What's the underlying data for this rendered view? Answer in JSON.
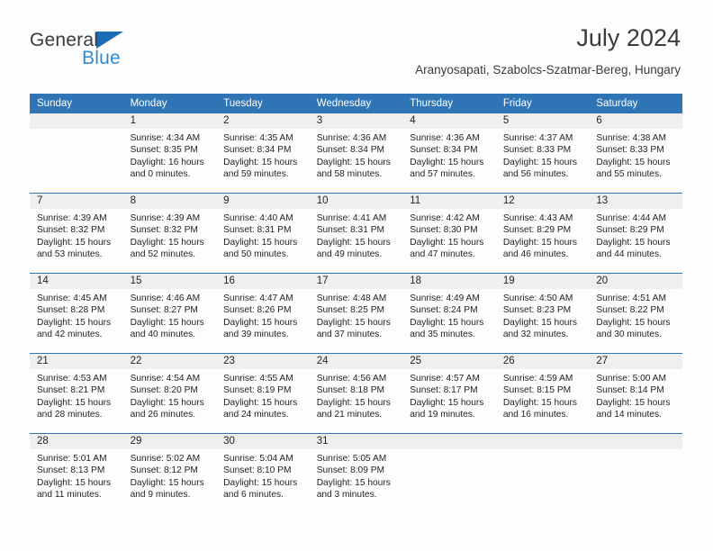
{
  "brand": {
    "name_part1": "General",
    "name_part2": "Blue",
    "logo_icon": "triangle-logo-icon"
  },
  "header": {
    "title": "July 2024",
    "subtitle": "Aranyosapati, Szabolcs-Szatmar-Bereg, Hungary"
  },
  "colors": {
    "header_blue": "#2f74b5",
    "brand_blue": "#2e8bd4",
    "daynum_band": "#efefef",
    "text": "#231f20"
  },
  "weekdays": [
    "Sunday",
    "Monday",
    "Tuesday",
    "Wednesday",
    "Thursday",
    "Friday",
    "Saturday"
  ],
  "weeks": [
    [
      {
        "day": "",
        "sunrise": "",
        "sunset": "",
        "daylight_1": "",
        "daylight_2": ""
      },
      {
        "day": "1",
        "sunrise": "Sunrise: 4:34 AM",
        "sunset": "Sunset: 8:35 PM",
        "daylight_1": "Daylight: 16 hours",
        "daylight_2": "and 0 minutes."
      },
      {
        "day": "2",
        "sunrise": "Sunrise: 4:35 AM",
        "sunset": "Sunset: 8:34 PM",
        "daylight_1": "Daylight: 15 hours",
        "daylight_2": "and 59 minutes."
      },
      {
        "day": "3",
        "sunrise": "Sunrise: 4:36 AM",
        "sunset": "Sunset: 8:34 PM",
        "daylight_1": "Daylight: 15 hours",
        "daylight_2": "and 58 minutes."
      },
      {
        "day": "4",
        "sunrise": "Sunrise: 4:36 AM",
        "sunset": "Sunset: 8:34 PM",
        "daylight_1": "Daylight: 15 hours",
        "daylight_2": "and 57 minutes."
      },
      {
        "day": "5",
        "sunrise": "Sunrise: 4:37 AM",
        "sunset": "Sunset: 8:33 PM",
        "daylight_1": "Daylight: 15 hours",
        "daylight_2": "and 56 minutes."
      },
      {
        "day": "6",
        "sunrise": "Sunrise: 4:38 AM",
        "sunset": "Sunset: 8:33 PM",
        "daylight_1": "Daylight: 15 hours",
        "daylight_2": "and 55 minutes."
      }
    ],
    [
      {
        "day": "7",
        "sunrise": "Sunrise: 4:39 AM",
        "sunset": "Sunset: 8:32 PM",
        "daylight_1": "Daylight: 15 hours",
        "daylight_2": "and 53 minutes."
      },
      {
        "day": "8",
        "sunrise": "Sunrise: 4:39 AM",
        "sunset": "Sunset: 8:32 PM",
        "daylight_1": "Daylight: 15 hours",
        "daylight_2": "and 52 minutes."
      },
      {
        "day": "9",
        "sunrise": "Sunrise: 4:40 AM",
        "sunset": "Sunset: 8:31 PM",
        "daylight_1": "Daylight: 15 hours",
        "daylight_2": "and 50 minutes."
      },
      {
        "day": "10",
        "sunrise": "Sunrise: 4:41 AM",
        "sunset": "Sunset: 8:31 PM",
        "daylight_1": "Daylight: 15 hours",
        "daylight_2": "and 49 minutes."
      },
      {
        "day": "11",
        "sunrise": "Sunrise: 4:42 AM",
        "sunset": "Sunset: 8:30 PM",
        "daylight_1": "Daylight: 15 hours",
        "daylight_2": "and 47 minutes."
      },
      {
        "day": "12",
        "sunrise": "Sunrise: 4:43 AM",
        "sunset": "Sunset: 8:29 PM",
        "daylight_1": "Daylight: 15 hours",
        "daylight_2": "and 46 minutes."
      },
      {
        "day": "13",
        "sunrise": "Sunrise: 4:44 AM",
        "sunset": "Sunset: 8:29 PM",
        "daylight_1": "Daylight: 15 hours",
        "daylight_2": "and 44 minutes."
      }
    ],
    [
      {
        "day": "14",
        "sunrise": "Sunrise: 4:45 AM",
        "sunset": "Sunset: 8:28 PM",
        "daylight_1": "Daylight: 15 hours",
        "daylight_2": "and 42 minutes."
      },
      {
        "day": "15",
        "sunrise": "Sunrise: 4:46 AM",
        "sunset": "Sunset: 8:27 PM",
        "daylight_1": "Daylight: 15 hours",
        "daylight_2": "and 40 minutes."
      },
      {
        "day": "16",
        "sunrise": "Sunrise: 4:47 AM",
        "sunset": "Sunset: 8:26 PM",
        "daylight_1": "Daylight: 15 hours",
        "daylight_2": "and 39 minutes."
      },
      {
        "day": "17",
        "sunrise": "Sunrise: 4:48 AM",
        "sunset": "Sunset: 8:25 PM",
        "daylight_1": "Daylight: 15 hours",
        "daylight_2": "and 37 minutes."
      },
      {
        "day": "18",
        "sunrise": "Sunrise: 4:49 AM",
        "sunset": "Sunset: 8:24 PM",
        "daylight_1": "Daylight: 15 hours",
        "daylight_2": "and 35 minutes."
      },
      {
        "day": "19",
        "sunrise": "Sunrise: 4:50 AM",
        "sunset": "Sunset: 8:23 PM",
        "daylight_1": "Daylight: 15 hours",
        "daylight_2": "and 32 minutes."
      },
      {
        "day": "20",
        "sunrise": "Sunrise: 4:51 AM",
        "sunset": "Sunset: 8:22 PM",
        "daylight_1": "Daylight: 15 hours",
        "daylight_2": "and 30 minutes."
      }
    ],
    [
      {
        "day": "21",
        "sunrise": "Sunrise: 4:53 AM",
        "sunset": "Sunset: 8:21 PM",
        "daylight_1": "Daylight: 15 hours",
        "daylight_2": "and 28 minutes."
      },
      {
        "day": "22",
        "sunrise": "Sunrise: 4:54 AM",
        "sunset": "Sunset: 8:20 PM",
        "daylight_1": "Daylight: 15 hours",
        "daylight_2": "and 26 minutes."
      },
      {
        "day": "23",
        "sunrise": "Sunrise: 4:55 AM",
        "sunset": "Sunset: 8:19 PM",
        "daylight_1": "Daylight: 15 hours",
        "daylight_2": "and 24 minutes."
      },
      {
        "day": "24",
        "sunrise": "Sunrise: 4:56 AM",
        "sunset": "Sunset: 8:18 PM",
        "daylight_1": "Daylight: 15 hours",
        "daylight_2": "and 21 minutes."
      },
      {
        "day": "25",
        "sunrise": "Sunrise: 4:57 AM",
        "sunset": "Sunset: 8:17 PM",
        "daylight_1": "Daylight: 15 hours",
        "daylight_2": "and 19 minutes."
      },
      {
        "day": "26",
        "sunrise": "Sunrise: 4:59 AM",
        "sunset": "Sunset: 8:15 PM",
        "daylight_1": "Daylight: 15 hours",
        "daylight_2": "and 16 minutes."
      },
      {
        "day": "27",
        "sunrise": "Sunrise: 5:00 AM",
        "sunset": "Sunset: 8:14 PM",
        "daylight_1": "Daylight: 15 hours",
        "daylight_2": "and 14 minutes."
      }
    ],
    [
      {
        "day": "28",
        "sunrise": "Sunrise: 5:01 AM",
        "sunset": "Sunset: 8:13 PM",
        "daylight_1": "Daylight: 15 hours",
        "daylight_2": "and 11 minutes."
      },
      {
        "day": "29",
        "sunrise": "Sunrise: 5:02 AM",
        "sunset": "Sunset: 8:12 PM",
        "daylight_1": "Daylight: 15 hours",
        "daylight_2": "and 9 minutes."
      },
      {
        "day": "30",
        "sunrise": "Sunrise: 5:04 AM",
        "sunset": "Sunset: 8:10 PM",
        "daylight_1": "Daylight: 15 hours",
        "daylight_2": "and 6 minutes."
      },
      {
        "day": "31",
        "sunrise": "Sunrise: 5:05 AM",
        "sunset": "Sunset: 8:09 PM",
        "daylight_1": "Daylight: 15 hours",
        "daylight_2": "and 3 minutes."
      },
      {
        "day": "",
        "sunrise": "",
        "sunset": "",
        "daylight_1": "",
        "daylight_2": ""
      },
      {
        "day": "",
        "sunrise": "",
        "sunset": "",
        "daylight_1": "",
        "daylight_2": ""
      },
      {
        "day": "",
        "sunrise": "",
        "sunset": "",
        "daylight_1": "",
        "daylight_2": ""
      }
    ]
  ]
}
